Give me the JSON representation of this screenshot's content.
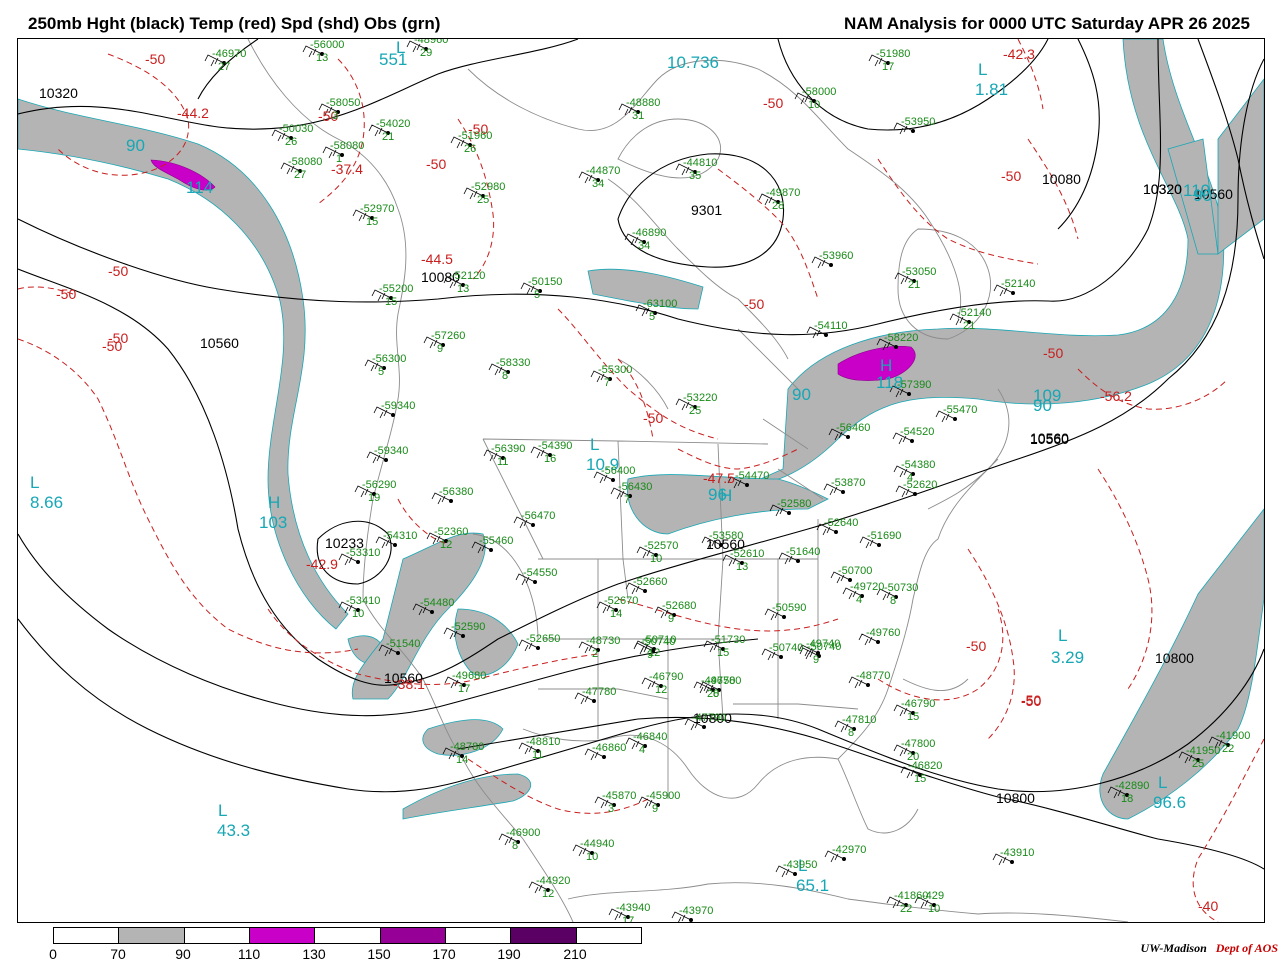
{
  "header": {
    "left_title": "250mb Hght (black) Temp (red) Spd (shd) Obs (grn)",
    "right_title": "NAM Analysis for 0000 UTC Saturday  APR 26 2025"
  },
  "colors": {
    "height_contour": "#000000",
    "temp_contour": "#c81e1e",
    "speed_label": "#17a7b5",
    "obs": "#188a18",
    "boundary": "#8c8c8c",
    "speed_70_90": "#b4b4b4",
    "speed_110_130": "#c800c8",
    "speed_150_170": "#960096",
    "speed_190_210": "#5a0064"
  },
  "height_labels": [
    "10320",
    "10080",
    "10560",
    "10233",
    "10560",
    "10560",
    "10800",
    "10080",
    "10320",
    "10560",
    "10320",
    "10560",
    "10800",
    "10800",
    "9301",
    "10560"
  ],
  "temp_labels": [
    "-50",
    "-44.2",
    "-50",
    "-37.4",
    "-50",
    "-44.5",
    "-50",
    "-50",
    "-50",
    "-50",
    "-42.9",
    "-38.1",
    "-50",
    "-47.5",
    "-50",
    "-50",
    "-42.3",
    "-50",
    "-50",
    "-50",
    "-56.2",
    "-50",
    "-40",
    "-50",
    "-50"
  ],
  "speed_labels": [
    "90",
    "114",
    "L",
    "551",
    "L",
    "1.81",
    "H",
    "103",
    "L",
    "8.66",
    "L",
    "43.3",
    "L",
    "3.29",
    "90",
    "118",
    "H",
    "109",
    "90",
    "110",
    "90",
    "L",
    "10.9",
    "H",
    "96",
    "L",
    "65.1",
    "96.6",
    "L",
    "10.736"
  ],
  "observations": [
    {
      "temp": "-46",
      "hgt": "970",
      "dew": "27"
    },
    {
      "temp": "-56",
      "hgt": "000",
      "dew": "13"
    },
    {
      "temp": "-48",
      "hgt": "960",
      "dew": "29"
    },
    {
      "temp": "-58",
      "hgt": "050",
      "dew": "3"
    },
    {
      "temp": "-50",
      "hgt": "030",
      "dew": "26"
    },
    {
      "temp": "-54",
      "hgt": "020",
      "dew": "21"
    },
    {
      "temp": "-58",
      "hgt": "080",
      "dew": "1"
    },
    {
      "temp": "-58",
      "hgt": "080",
      "dew": "27"
    },
    {
      "temp": "-51",
      "hgt": "960",
      "dew": "26"
    },
    {
      "temp": "-52",
      "hgt": "980",
      "dew": "25"
    },
    {
      "temp": "-52",
      "hgt": "970",
      "dew": "15"
    },
    {
      "temp": "-44",
      "hgt": "870",
      "dew": "34"
    },
    {
      "temp": "-44",
      "hgt": "810",
      "dew": "35"
    },
    {
      "temp": "-49",
      "hgt": "870",
      "dew": "28"
    },
    {
      "temp": "-48",
      "hgt": "880",
      "dew": "31"
    },
    {
      "temp": "-46",
      "hgt": "890",
      "dew": "34"
    },
    {
      "temp": "-58",
      "hgt": "000",
      "dew": "10"
    },
    {
      "temp": "-51",
      "hgt": "980",
      "dew": "17"
    },
    {
      "temp": "-53",
      "hgt": "950",
      "dew": ""
    },
    {
      "temp": "-55",
      "hgt": "200",
      "dew": "15"
    },
    {
      "temp": "-52",
      "hgt": "120",
      "dew": "13"
    },
    {
      "temp": "-50",
      "hgt": "150",
      "dew": "5"
    },
    {
      "temp": "-63",
      "hgt": "100",
      "dew": "5"
    },
    {
      "temp": "-53",
      "hgt": "960",
      "dew": ""
    },
    {
      "temp": "-53",
      "hgt": "050",
      "dew": "21"
    },
    {
      "temp": "-52",
      "hgt": "140",
      "dew": ""
    },
    {
      "temp": "-52",
      "hgt": "140",
      "dew": "21"
    },
    {
      "temp": "-54",
      "hgt": "110",
      "dew": ""
    },
    {
      "temp": "-58",
      "hgt": "220",
      "dew": ""
    },
    {
      "temp": "-57",
      "hgt": "260",
      "dew": "9"
    },
    {
      "temp": "-56",
      "hgt": "300",
      "dew": "5"
    },
    {
      "temp": "-58",
      "hgt": "330",
      "dew": "8"
    },
    {
      "temp": "-55",
      "hgt": "300",
      "dew": "7"
    },
    {
      "temp": "-53",
      "hgt": "220",
      "dew": "25"
    },
    {
      "temp": "-57",
      "hgt": "390",
      "dew": ""
    },
    {
      "temp": "-55",
      "hgt": "470",
      "dew": ""
    },
    {
      "temp": "-59",
      "hgt": "340",
      "dew": ""
    },
    {
      "temp": "-56",
      "hgt": "390",
      "dew": "11"
    },
    {
      "temp": "-54",
      "hgt": "390",
      "dew": "16"
    },
    {
      "temp": "-56",
      "hgt": "460",
      "dew": ""
    },
    {
      "temp": "-54",
      "hgt": "520",
      "dew": ""
    },
    {
      "temp": "-59",
      "hgt": "340",
      "dew": ""
    },
    {
      "temp": "-56",
      "hgt": "290",
      "dew": "19"
    },
    {
      "temp": "-56",
      "hgt": "380",
      "dew": ""
    },
    {
      "temp": "-56",
      "hgt": "400",
      "dew": ""
    },
    {
      "temp": "-56",
      "hgt": "430",
      "dew": "7"
    },
    {
      "temp": "-54",
      "hgt": "470",
      "dew": ""
    },
    {
      "temp": "-53",
      "hgt": "870",
      "dew": ""
    },
    {
      "temp": "-54",
      "hgt": "380",
      "dew": "4"
    },
    {
      "temp": "-52",
      "hgt": "620",
      "dew": ""
    },
    {
      "temp": "-56",
      "hgt": "470",
      "dew": ""
    },
    {
      "temp": "-52",
      "hgt": "580",
      "dew": ""
    },
    {
      "temp": "-52",
      "hgt": "640",
      "dew": ""
    },
    {
      "temp": "-51",
      "hgt": "690",
      "dew": ""
    },
    {
      "temp": "-54",
      "hgt": "310",
      "dew": ""
    },
    {
      "temp": "-52",
      "hgt": "360",
      "dew": "12"
    },
    {
      "temp": "-55",
      "hgt": "460",
      "dew": ""
    },
    {
      "temp": "-53",
      "hgt": "310",
      "dew": ""
    },
    {
      "temp": "-52",
      "hgt": "570",
      "dew": "10"
    },
    {
      "temp": "-53",
      "hgt": "580",
      "dew": ""
    },
    {
      "temp": "-52",
      "hgt": "610",
      "dew": "13"
    },
    {
      "temp": "-51",
      "hgt": "640",
      "dew": ""
    },
    {
      "temp": "-50",
      "hgt": "700",
      "dew": ""
    },
    {
      "temp": "-54",
      "hgt": "550",
      "dew": ""
    },
    {
      "temp": "-52",
      "hgt": "660",
      "dew": ""
    },
    {
      "temp": "-53",
      "hgt": "410",
      "dew": "10"
    },
    {
      "temp": "-54",
      "hgt": "480",
      "dew": ""
    },
    {
      "temp": "-52",
      "hgt": "670",
      "dew": "14"
    },
    {
      "temp": "-52",
      "hgt": "680",
      "dew": "9"
    },
    {
      "temp": "-50",
      "hgt": "590",
      "dew": ""
    },
    {
      "temp": "-49",
      "hgt": "720",
      "dew": "4"
    },
    {
      "temp": "-50",
      "hgt": "730",
      "dew": "8"
    },
    {
      "temp": "-52",
      "hgt": "590",
      "dew": ""
    },
    {
      "temp": "-51",
      "hgt": "540",
      "dew": ""
    },
    {
      "temp": "-52",
      "hgt": "650",
      "dew": ""
    },
    {
      "temp": "-48",
      "hgt": "730",
      "dew": "2"
    },
    {
      "temp": "-50",
      "hgt": "710",
      "dew": "12"
    },
    {
      "temp": "-50",
      "hgt": "740",
      "dew": "9"
    },
    {
      "temp": "-51",
      "hgt": "730",
      "dew": "15"
    },
    {
      "temp": "-50",
      "hgt": "740",
      "dew": ""
    },
    {
      "temp": "-49",
      "hgt": "740",
      "dew": ""
    },
    {
      "temp": "-49",
      "hgt": "760",
      "dew": ""
    },
    {
      "temp": "-49",
      "hgt": "680",
      "dew": "17"
    },
    {
      "temp": "-50",
      "hgt": "740",
      "dew": "9"
    },
    {
      "temp": "-47",
      "hgt": "780",
      "dew": ""
    },
    {
      "temp": "-46",
      "hgt": "790",
      "dew": "12"
    },
    {
      "temp": "-46",
      "hgt": "780",
      "dew": "8"
    },
    {
      "temp": "-49",
      "hgt": "750",
      "dew": "20"
    },
    {
      "temp": "-48",
      "hgt": "770",
      "dew": ""
    },
    {
      "temp": "-46",
      "hgt": "790",
      "dew": "15"
    },
    {
      "temp": "-47",
      "hgt": "790",
      "dew": ""
    },
    {
      "temp": "-47",
      "hgt": "810",
      "dew": "8"
    },
    {
      "temp": "-48",
      "hgt": "780",
      "dew": "14"
    },
    {
      "temp": "-48",
      "hgt": "810",
      "dew": "11"
    },
    {
      "temp": "-46",
      "hgt": "840",
      "dew": "4"
    },
    {
      "temp": "-46",
      "hgt": "860",
      "dew": ""
    },
    {
      "temp": "-47",
      "hgt": "800",
      "dew": "20"
    },
    {
      "temp": "-46",
      "hgt": "820",
      "dew": "15"
    },
    {
      "temp": "-45",
      "hgt": "870",
      "dew": "3"
    },
    {
      "temp": "-45",
      "hgt": "900",
      "dew": "9"
    },
    {
      "temp": "-46",
      "hgt": "900",
      "dew": "8"
    },
    {
      "temp": "-44",
      "hgt": "940",
      "dew": "10"
    },
    {
      "temp": "-44",
      "hgt": "920",
      "dew": "12"
    },
    {
      "temp": "-43",
      "hgt": "940",
      "dew": "17"
    },
    {
      "temp": "-43",
      "hgt": "970",
      "dew": ""
    },
    {
      "temp": "-42",
      "hgt": "970",
      "dew": ""
    },
    {
      "temp": "-43",
      "hgt": "950",
      "dew": ""
    },
    {
      "temp": "-43",
      "hgt": "910",
      "dew": ""
    },
    {
      "temp": "-41",
      "hgt": "950",
      "dew": "25"
    },
    {
      "temp": "-42",
      "hgt": "890",
      "dew": "18"
    },
    {
      "temp": "-41",
      "hgt": "900",
      "dew": "22"
    },
    {
      "temp": "-41",
      "hgt": "860",
      "dew": "22"
    },
    {
      "temp": "-42",
      "hgt": "9",
      "dew": "10"
    }
  ],
  "scale": {
    "ticks": [
      "0",
      "70",
      "90",
      "110",
      "130",
      "150",
      "170",
      "190",
      "210"
    ]
  },
  "credit": {
    "left": "UW-Madison",
    "right": "Dept of AOS"
  }
}
